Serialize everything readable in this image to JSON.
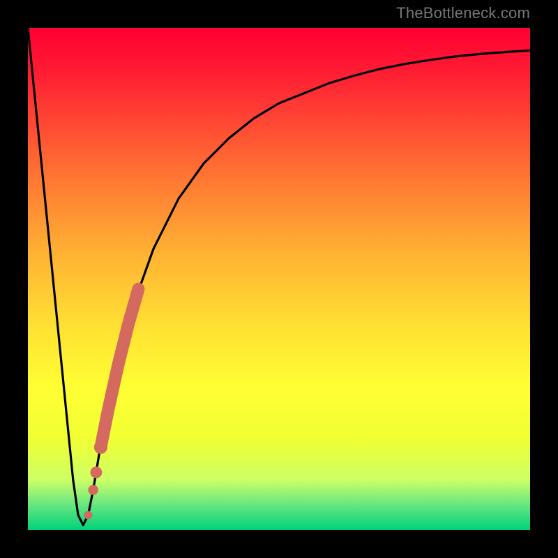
{
  "citation": "TheBottleneck.com",
  "colors": {
    "curve": "#000000",
    "marker": "#d46a5f",
    "border": "#000000",
    "gradient_stops": [
      "#ff0033",
      "#ff4433",
      "#ffb233",
      "#ffff33",
      "#ccff66",
      "#00d27a"
    ]
  },
  "chart_data": {
    "type": "line",
    "title": "",
    "xlabel": "",
    "ylabel": "",
    "xlim": [
      0,
      100
    ],
    "ylim": [
      0,
      100
    ],
    "series": [
      {
        "name": "bottleneck-curve",
        "x": [
          0,
          3,
          6,
          9,
          10,
          11,
          12,
          13,
          14,
          15,
          17,
          20,
          25,
          30,
          35,
          40,
          45,
          50,
          55,
          60,
          65,
          70,
          75,
          80,
          85,
          90,
          95,
          100
        ],
        "y": [
          100,
          70,
          40,
          10,
          3,
          1,
          3,
          8,
          14,
          20,
          30,
          42,
          56,
          66,
          73,
          78,
          82,
          85,
          87,
          89,
          90.5,
          91.8,
          92.8,
          93.6,
          94.3,
          94.8,
          95.2,
          95.5
        ]
      }
    ],
    "markers": [
      {
        "name": "highlight-segment",
        "color": "#d46a5f",
        "points": [
          {
            "x": 12.0,
            "y": 3.0
          },
          {
            "x": 13.0,
            "y": 8.0
          },
          {
            "x": 13.6,
            "y": 11.5
          },
          {
            "x": 14.5,
            "y": 16.5
          },
          {
            "x": 16.0,
            "y": 24.0
          },
          {
            "x": 18.0,
            "y": 33.0
          },
          {
            "x": 20.0,
            "y": 41.0
          },
          {
            "x": 22.0,
            "y": 48.0
          }
        ]
      }
    ]
  }
}
